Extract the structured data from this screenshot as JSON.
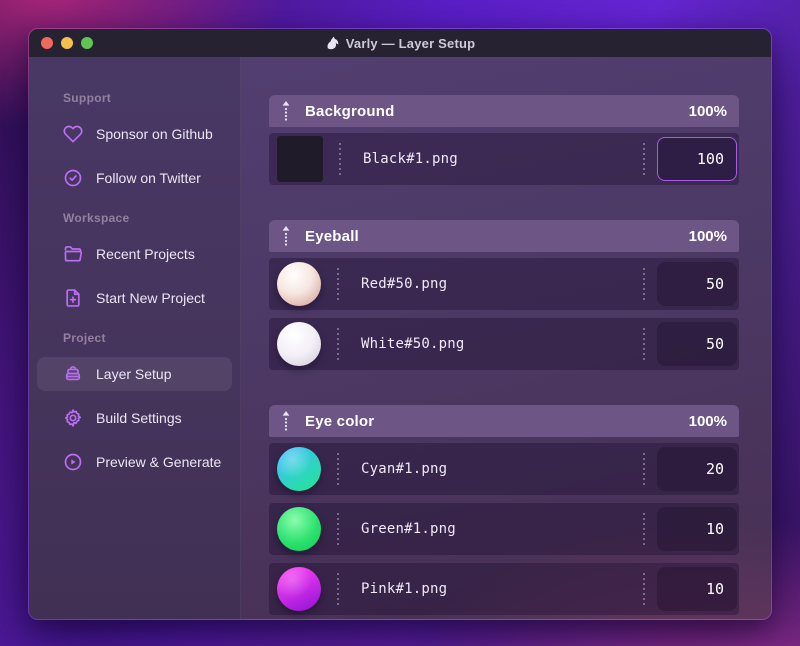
{
  "window": {
    "title": "Varly — Layer Setup",
    "app_icon": "unicorn-icon"
  },
  "titlebar": {
    "traffic_lights": [
      "close",
      "minimize",
      "zoom"
    ]
  },
  "sidebar": {
    "sections": [
      {
        "label": "Support",
        "items": [
          {
            "icon": "heart-icon",
            "label": "Sponsor on Github",
            "selected": false
          },
          {
            "icon": "check-circle-icon",
            "label": "Follow on Twitter",
            "selected": false
          }
        ]
      },
      {
        "label": "Workspace",
        "items": [
          {
            "icon": "folder-icon",
            "label": "Recent Projects",
            "selected": false
          },
          {
            "icon": "file-plus-icon",
            "label": "Start New Project",
            "selected": false
          }
        ]
      },
      {
        "label": "Project",
        "items": [
          {
            "icon": "layers-icon",
            "label": "Layer Setup",
            "selected": true
          },
          {
            "icon": "gear-icon",
            "label": "Build Settings",
            "selected": false
          },
          {
            "icon": "play-circle-icon",
            "label": "Preview & Generate",
            "selected": false
          }
        ]
      }
    ]
  },
  "layers": {
    "groups": [
      {
        "name": "Background",
        "weight": "100%",
        "items": [
          {
            "file": "Black#1.png",
            "value": "100",
            "thumb": "black-square",
            "focused": true
          }
        ]
      },
      {
        "name": "Eyeball",
        "weight": "100%",
        "items": [
          {
            "file": "Red#50.png",
            "value": "50",
            "thumb": "red-sphere",
            "focused": false
          },
          {
            "file": "White#50.png",
            "value": "50",
            "thumb": "white-sphere",
            "focused": false
          }
        ]
      },
      {
        "name": "Eye color",
        "weight": "100%",
        "items": [
          {
            "file": "Cyan#1.png",
            "value": "20",
            "thumb": "cyan-sphere",
            "focused": false
          },
          {
            "file": "Green#1.png",
            "value": "10",
            "thumb": "green-sphere",
            "focused": false
          },
          {
            "file": "Pink#1.png",
            "value": "10",
            "thumb": "pink-sphere",
            "focused": false
          }
        ]
      }
    ]
  },
  "colors": {
    "accent_focus_border": "#a95ce8",
    "sidebar_icon": "#bb6ef5",
    "group_header_bg": "#6d5685",
    "titlebar_bg": "#272231",
    "traffic_red": "#ee6a5f",
    "traffic_yellow": "#f5bf4f",
    "traffic_green": "#61c554"
  }
}
